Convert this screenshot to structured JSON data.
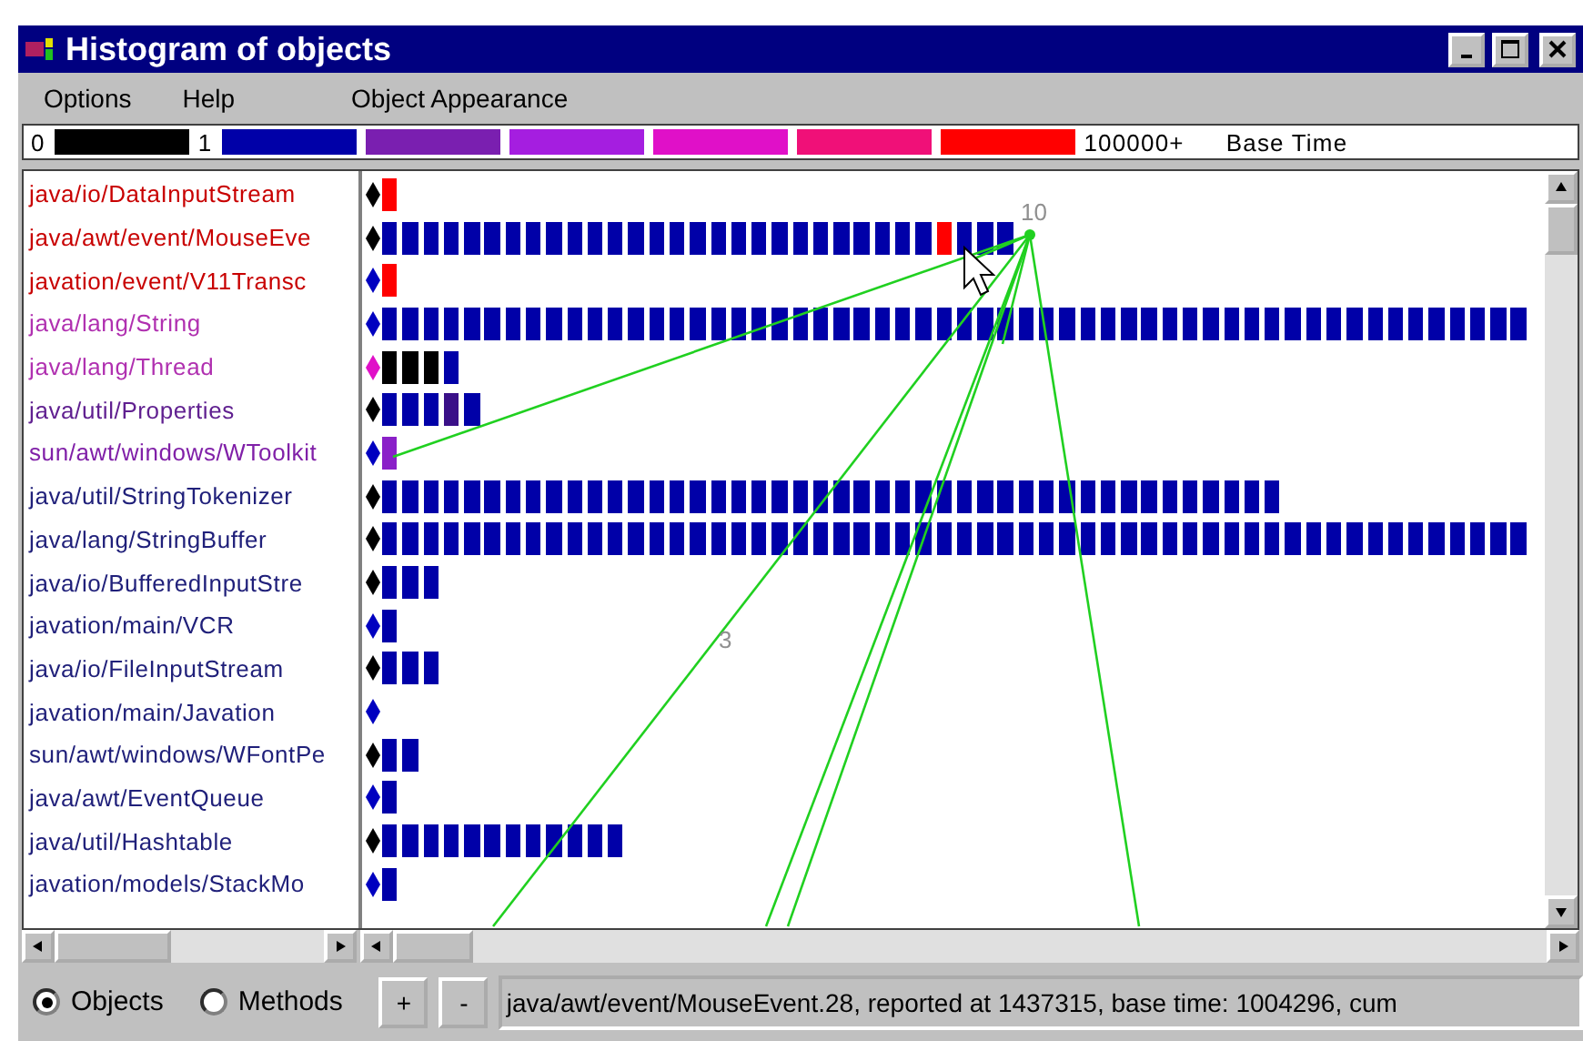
{
  "window": {
    "title": "Histogram of objects"
  },
  "menu": [
    "Options",
    "Help",
    "Object Appearance"
  ],
  "legend": [
    {
      "kind": "label",
      "text": "0"
    },
    {
      "kind": "swatch",
      "color": "#000000"
    },
    {
      "kind": "label",
      "text": "1"
    },
    {
      "kind": "swatch",
      "color": "#0000a8"
    },
    {
      "kind": "swatch",
      "color": "#7a1fb0"
    },
    {
      "kind": "swatch",
      "color": "#a51ee0"
    },
    {
      "kind": "swatch",
      "color": "#e010c8"
    },
    {
      "kind": "swatch",
      "color": "#f01078"
    },
    {
      "kind": "swatch",
      "color": "#ff0000"
    },
    {
      "kind": "label",
      "text": "100000+"
    },
    {
      "kind": "label",
      "text": "Base Time"
    }
  ],
  "rows": [
    {
      "name": {
        "text": "java/io/DataInputStream",
        "color": "#c80000"
      },
      "marker": {
        "color": "#000000"
      },
      "blocks": [
        {
          "color": "#ff0000"
        }
      ]
    },
    {
      "name": {
        "text": "java/awt/event/MouseEve",
        "color": "#c80000"
      },
      "marker": {
        "color": "#000000"
      },
      "blocks": [
        {
          "color": "#0000a8"
        },
        {
          "color": "#0000a8"
        },
        {
          "color": "#0000a8"
        },
        {
          "color": "#0000a8"
        },
        {
          "color": "#0000a8"
        },
        {
          "color": "#0000a8"
        },
        {
          "color": "#0000a8"
        },
        {
          "color": "#0000a8"
        },
        {
          "color": "#0000a8"
        },
        {
          "color": "#0000a8"
        },
        {
          "color": "#0000a8"
        },
        {
          "color": "#0000a8"
        },
        {
          "color": "#0000a8"
        },
        {
          "color": "#0000a8"
        },
        {
          "color": "#0000a8"
        },
        {
          "color": "#0000a8"
        },
        {
          "color": "#0000a8"
        },
        {
          "color": "#0000a8"
        },
        {
          "color": "#0000a8"
        },
        {
          "color": "#0000a8"
        },
        {
          "color": "#0000a8"
        },
        {
          "color": "#0000a8"
        },
        {
          "color": "#0000a8"
        },
        {
          "color": "#0000a8"
        },
        {
          "color": "#0000a8"
        },
        {
          "color": "#0000a8"
        },
        {
          "color": "#0000a8"
        },
        {
          "color": "#ff0000"
        },
        {
          "color": "#0000a8"
        },
        {
          "color": "#0000a8"
        },
        {
          "color": "#0000a8"
        }
      ]
    },
    {
      "name": {
        "text": "javation/event/V11Transc",
        "color": "#c80000"
      },
      "marker": {
        "color": "#0000c0"
      },
      "blocks": [
        {
          "color": "#ff0000"
        }
      ]
    },
    {
      "name": {
        "text": "java/lang/String",
        "color": "#b030b0"
      },
      "marker": {
        "color": "#0000c0"
      },
      "blocks": [
        {
          "color": "#0000a8"
        },
        {
          "color": "#0000a8"
        },
        {
          "color": "#0000a8"
        },
        {
          "color": "#0000a8"
        },
        {
          "color": "#0000a8"
        },
        {
          "color": "#0000a8"
        },
        {
          "color": "#0000a8"
        },
        {
          "color": "#0000a8"
        },
        {
          "color": "#0000a8"
        },
        {
          "color": "#0000a8"
        },
        {
          "color": "#0000a8"
        },
        {
          "color": "#0000a8"
        },
        {
          "color": "#0000a8"
        },
        {
          "color": "#0000a8"
        },
        {
          "color": "#0000a8"
        },
        {
          "color": "#0000a8"
        },
        {
          "color": "#0000a8"
        },
        {
          "color": "#0000a8"
        },
        {
          "color": "#0000a8"
        },
        {
          "color": "#0000a8"
        },
        {
          "color": "#0000a8"
        },
        {
          "color": "#0000a8"
        },
        {
          "color": "#0000a8"
        },
        {
          "color": "#0000a8"
        },
        {
          "color": "#0000a8"
        },
        {
          "color": "#0000a8"
        },
        {
          "color": "#0000a8"
        },
        {
          "color": "#0000a8"
        },
        {
          "color": "#0000a8"
        },
        {
          "color": "#0000a8"
        },
        {
          "color": "#0000a8"
        },
        {
          "color": "#0000a8"
        },
        {
          "color": "#0000a8"
        },
        {
          "color": "#0000a8"
        },
        {
          "color": "#0000a8"
        },
        {
          "color": "#0000a8"
        },
        {
          "color": "#0000a8"
        },
        {
          "color": "#0000a8"
        },
        {
          "color": "#0000a8"
        },
        {
          "color": "#0000a8"
        },
        {
          "color": "#0000a8"
        },
        {
          "color": "#0000a8"
        },
        {
          "color": "#0000a8"
        },
        {
          "color": "#0000a8"
        },
        {
          "color": "#0000a8"
        },
        {
          "color": "#0000a8"
        },
        {
          "color": "#0000a8"
        },
        {
          "color": "#0000a8"
        },
        {
          "color": "#0000a8"
        },
        {
          "color": "#0000a8"
        },
        {
          "color": "#0000a8"
        },
        {
          "color": "#0000a8"
        },
        {
          "color": "#0000a8"
        },
        {
          "color": "#0000a8"
        },
        {
          "color": "#0000a8"
        },
        {
          "color": "#0000a8"
        }
      ]
    },
    {
      "name": {
        "text": "java/lang/Thread",
        "color": "#b030b0"
      },
      "marker": {
        "color": "#e010c8"
      },
      "blocks": [
        {
          "color": "#000000"
        },
        {
          "color": "#000000"
        },
        {
          "color": "#000000"
        },
        {
          "color": "#0000a8"
        }
      ]
    },
    {
      "name": {
        "text": "java/util/Properties",
        "color": "#602090"
      },
      "marker": {
        "color": "#000000"
      },
      "blocks": [
        {
          "color": "#0000a8"
        },
        {
          "color": "#0000a8"
        },
        {
          "color": "#0000a8"
        },
        {
          "color": "#3a1088"
        },
        {
          "color": "#0000a8"
        }
      ]
    },
    {
      "name": {
        "text": "sun/awt/windows/WToolkit",
        "color": "#8020a8"
      },
      "marker": {
        "color": "#0000c0"
      },
      "blocks": [
        {
          "color": "#8a20c8"
        }
      ]
    },
    {
      "name": {
        "text": "java/util/StringTokenizer",
        "color": "#20207a"
      },
      "marker": {
        "color": "#000000"
      },
      "blocks": [
        {
          "color": "#0000a8"
        },
        {
          "color": "#0000a8"
        },
        {
          "color": "#0000a8"
        },
        {
          "color": "#0000a8"
        },
        {
          "color": "#0000a8"
        },
        {
          "color": "#0000a8"
        },
        {
          "color": "#0000a8"
        },
        {
          "color": "#0000a8"
        },
        {
          "color": "#0000a8"
        },
        {
          "color": "#0000a8"
        },
        {
          "color": "#0000a8"
        },
        {
          "color": "#0000a8"
        },
        {
          "color": "#0000a8"
        },
        {
          "color": "#0000a8"
        },
        {
          "color": "#0000a8"
        },
        {
          "color": "#0000a8"
        },
        {
          "color": "#0000a8"
        },
        {
          "color": "#0000a8"
        },
        {
          "color": "#0000a8"
        },
        {
          "color": "#0000a8"
        },
        {
          "color": "#0000a8"
        },
        {
          "color": "#0000a8"
        },
        {
          "color": "#0000a8"
        },
        {
          "color": "#0000a8"
        },
        {
          "color": "#0000a8"
        },
        {
          "color": "#0000a8"
        },
        {
          "color": "#0000a8"
        },
        {
          "color": "#0000a8"
        },
        {
          "color": "#0000a8"
        },
        {
          "color": "#0000a8"
        },
        {
          "color": "#0000a8"
        },
        {
          "color": "#0000a8"
        },
        {
          "color": "#0000a8"
        },
        {
          "color": "#0000a8"
        },
        {
          "color": "#0000a8"
        },
        {
          "color": "#0000a8"
        },
        {
          "color": "#0000a8"
        },
        {
          "color": "#0000a8"
        },
        {
          "color": "#0000a8"
        },
        {
          "color": "#0000a8"
        },
        {
          "color": "#0000a8"
        },
        {
          "color": "#0000a8"
        },
        {
          "color": "#0000a8"
        },
        {
          "color": "#0000a8"
        }
      ]
    },
    {
      "name": {
        "text": "java/lang/StringBuffer",
        "color": "#20207a"
      },
      "marker": {
        "color": "#000000"
      },
      "blocks": [
        {
          "color": "#0000a8"
        },
        {
          "color": "#0000a8"
        },
        {
          "color": "#0000a8"
        },
        {
          "color": "#0000a8"
        },
        {
          "color": "#0000a8"
        },
        {
          "color": "#0000a8"
        },
        {
          "color": "#0000a8"
        },
        {
          "color": "#0000a8"
        },
        {
          "color": "#0000a8"
        },
        {
          "color": "#0000a8"
        },
        {
          "color": "#0000a8"
        },
        {
          "color": "#0000a8"
        },
        {
          "color": "#0000a8"
        },
        {
          "color": "#0000a8"
        },
        {
          "color": "#0000a8"
        },
        {
          "color": "#0000a8"
        },
        {
          "color": "#0000a8"
        },
        {
          "color": "#0000a8"
        },
        {
          "color": "#0000a8"
        },
        {
          "color": "#0000a8"
        },
        {
          "color": "#0000a8"
        },
        {
          "color": "#0000a8"
        },
        {
          "color": "#0000a8"
        },
        {
          "color": "#0000a8"
        },
        {
          "color": "#0000a8"
        },
        {
          "color": "#0000a8"
        },
        {
          "color": "#0000a8"
        },
        {
          "color": "#0000a8"
        },
        {
          "color": "#0000a8"
        },
        {
          "color": "#0000a8"
        },
        {
          "color": "#0000a8"
        },
        {
          "color": "#0000a8"
        },
        {
          "color": "#0000a8"
        },
        {
          "color": "#0000a8"
        },
        {
          "color": "#0000a8"
        },
        {
          "color": "#0000a8"
        },
        {
          "color": "#0000a8"
        },
        {
          "color": "#0000a8"
        },
        {
          "color": "#0000a8"
        },
        {
          "color": "#0000a8"
        },
        {
          "color": "#0000a8"
        },
        {
          "color": "#0000a8"
        },
        {
          "color": "#0000a8"
        },
        {
          "color": "#0000a8"
        },
        {
          "color": "#0000a8"
        },
        {
          "color": "#0000a8"
        },
        {
          "color": "#0000a8"
        },
        {
          "color": "#0000a8"
        },
        {
          "color": "#0000a8"
        },
        {
          "color": "#0000a8"
        },
        {
          "color": "#0000a8"
        },
        {
          "color": "#0000a8"
        },
        {
          "color": "#0000a8"
        },
        {
          "color": "#0000a8"
        },
        {
          "color": "#0000a8"
        },
        {
          "color": "#0000a8"
        }
      ]
    },
    {
      "name": {
        "text": "java/io/BufferedInputStre",
        "color": "#20207a"
      },
      "marker": {
        "color": "#000000"
      },
      "blocks": [
        {
          "color": "#0000a8"
        },
        {
          "color": "#0000a8"
        },
        {
          "color": "#0000a8"
        }
      ]
    },
    {
      "name": {
        "text": "javation/main/VCR",
        "color": "#20207a"
      },
      "marker": {
        "color": "#0000c0"
      },
      "blocks": [
        {
          "color": "#0000a8"
        }
      ]
    },
    {
      "name": {
        "text": "java/io/FileInputStream",
        "color": "#20207a"
      },
      "marker": {
        "color": "#000000"
      },
      "blocks": [
        {
          "color": "#0000a8"
        },
        {
          "color": "#0000a8"
        },
        {
          "color": "#0000a8"
        }
      ]
    },
    {
      "name": {
        "text": "javation/main/Javation",
        "color": "#20207a"
      },
      "marker": {
        "color": "#0000c0"
      }
    },
    {
      "name": {
        "text": "sun/awt/windows/WFontPe",
        "color": "#20207a"
      },
      "marker": {
        "color": "#000000"
      },
      "blocks": [
        {
          "color": "#0000a8"
        },
        {
          "color": "#0000a8"
        }
      ]
    },
    {
      "name": {
        "text": "java/awt/EventQueue",
        "color": "#20207a"
      },
      "marker": {
        "color": "#0000c0"
      },
      "blocks": [
        {
          "color": "#0000a8"
        }
      ]
    },
    {
      "name": {
        "text": "java/util/Hashtable",
        "color": "#20207a"
      },
      "marker": {
        "color": "#000000"
      },
      "blocks": [
        {
          "color": "#0000a8"
        },
        {
          "color": "#0000a8"
        },
        {
          "color": "#0000a8"
        },
        {
          "color": "#0000a8"
        },
        {
          "color": "#0000a8"
        },
        {
          "color": "#0000a8"
        },
        {
          "color": "#0000a8"
        },
        {
          "color": "#0000a8"
        },
        {
          "color": "#0000a8"
        },
        {
          "color": "#0000a8"
        },
        {
          "color": "#0000a8"
        },
        {
          "color": "#0000a8"
        }
      ]
    },
    {
      "name": {
        "text": "javation/models/StackMo",
        "color": "#20207a"
      },
      "marker": {
        "color": "#0000c0"
      },
      "blocks": [
        {
          "color": "#0000a8"
        }
      ]
    }
  ],
  "graph_labels": [
    "10",
    "3"
  ],
  "view_options": [
    {
      "label": "Objects",
      "selected": true
    },
    {
      "label": "Methods",
      "selected": false
    }
  ],
  "zoom_buttons": [
    "+",
    "-"
  ],
  "status": "java/awt/event/MouseEvent.28, reported at 1437315, base time: 1004296, cum"
}
